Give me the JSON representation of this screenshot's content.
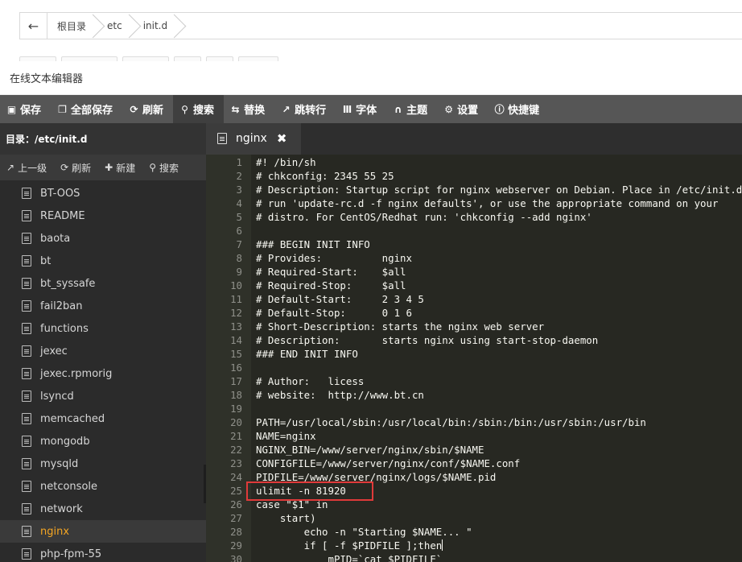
{
  "breadcrumb": {
    "items": [
      "根目录",
      "etc",
      "init.d"
    ]
  },
  "modal": {
    "title": "在线文本编辑器"
  },
  "toolbar": {
    "items": [
      {
        "label": "保存",
        "icon": "floppy-icon"
      },
      {
        "label": "全部保存",
        "icon": "copy-icon"
      },
      {
        "label": "刷新",
        "icon": "refresh-icon"
      },
      {
        "label": "搜索",
        "icon": "search-icon"
      },
      {
        "label": "替换",
        "icon": "replace-icon"
      },
      {
        "label": "跳转行",
        "icon": "goto-icon"
      },
      {
        "label": "字体",
        "icon": "text-cursor-icon"
      },
      {
        "label": "主题",
        "icon": "magnet-icon"
      },
      {
        "label": "设置",
        "icon": "gear-icon"
      },
      {
        "label": "快捷键",
        "icon": "info-icon"
      }
    ],
    "active": "搜索"
  },
  "sidebar": {
    "dir_label": "目录：/etc/init.d",
    "actions": [
      {
        "label": "上一级",
        "icon": "up-level-icon"
      },
      {
        "label": "刷新",
        "icon": "refresh-icon"
      },
      {
        "label": "新建",
        "icon": "plus-icon"
      },
      {
        "label": "搜索",
        "icon": "search-icon"
      }
    ],
    "files": [
      "BT-OOS",
      "README",
      "baota",
      "bt",
      "bt_syssafe",
      "fail2ban",
      "functions",
      "jexec",
      "jexec.rpmorig",
      "lsyncd",
      "memcached",
      "mongodb",
      "mysqld",
      "netconsole",
      "network",
      "nginx",
      "php-fpm-55"
    ],
    "active_file": "nginx"
  },
  "tab": {
    "label": "nginx"
  },
  "editor": {
    "highlight_line": 25,
    "cursor_line": 29,
    "lines": [
      "#! /bin/sh",
      "# chkconfig: 2345 55 25",
      "# Description: Startup script for nginx webserver on Debian. Place in /etc/init.d and",
      "# run 'update-rc.d -f nginx defaults', or use the appropriate command on your",
      "# distro. For CentOS/Redhat run: 'chkconfig --add nginx'",
      "",
      "### BEGIN INIT INFO",
      "# Provides:          nginx",
      "# Required-Start:    $all",
      "# Required-Stop:     $all",
      "# Default-Start:     2 3 4 5",
      "# Default-Stop:      0 1 6",
      "# Short-Description: starts the nginx web server",
      "# Description:       starts nginx using start-stop-daemon",
      "### END INIT INFO",
      "",
      "# Author:   licess",
      "# website:  http://www.bt.cn",
      "",
      "PATH=/usr/local/sbin:/usr/local/bin:/sbin:/bin:/usr/sbin:/usr/bin",
      "NAME=nginx",
      "NGINX_BIN=/www/server/nginx/sbin/$NAME",
      "CONFIGFILE=/www/server/nginx/conf/$NAME.conf",
      "PIDFILE=/www/server/nginx/logs/$NAME.pid",
      "ulimit -n 81920",
      "case \"$1\" in",
      "    start)",
      "        echo -n \"Starting $NAME... \"",
      "        if [ -f $PIDFILE ];then",
      "            mPID=`cat $PIDFILE`"
    ]
  }
}
